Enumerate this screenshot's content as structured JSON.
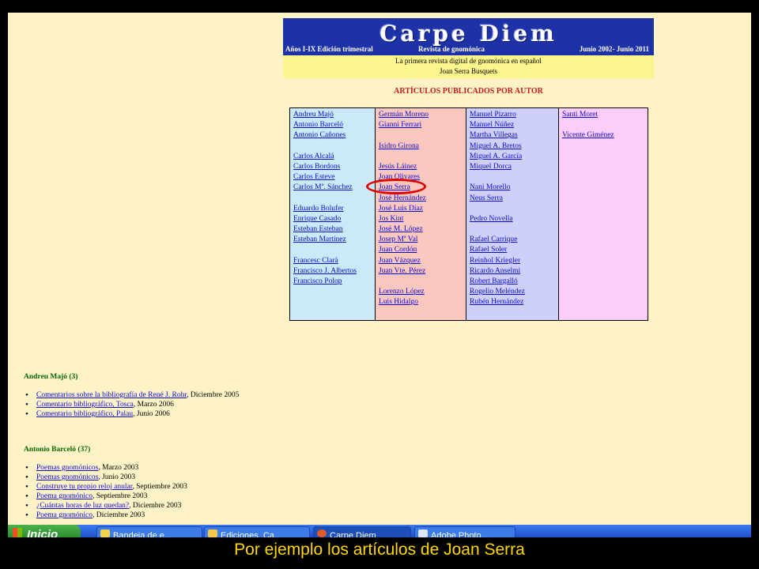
{
  "banner": {
    "logo": "Carpe Diem",
    "left": "Años I-IX Edición trimestral",
    "middle": "Revista de gnomónica",
    "right": "Junio 2002- Junio 2011",
    "line1": "La primera revista digital de gnomónica en español",
    "line2": "Joan Serra Busquets"
  },
  "heading": "ARTÍCULOS PUBLICADOS POR AUTOR",
  "columns": [
    [
      "Andreu Majó",
      "Antonio Barceló",
      "Antonio Cañones",
      "",
      "Carlos Alcalá",
      "Carlos Bordons",
      "Carlos Esteve",
      "Carlos Mª. Sánchez",
      "",
      "Eduardo Bolufer",
      "Enrique Casado",
      "Esteban Esteban",
      "Esteban Martínez",
      "",
      "Francesc Clarà",
      "Francisco J. Albertos",
      "Francisco Polop"
    ],
    [
      "Germán Moreno",
      "Gianni Ferrari",
      "",
      "Isidro Girona",
      "",
      "Jesús Láinez",
      "Joan Olivares",
      "Joan Serra",
      "José Hernández",
      "José Luis Díaz",
      "Jos Kint",
      "José M. López",
      "Josep Mª Val",
      "Juan Cordón",
      "Juan Vázquez",
      "Juan Vte. Pérez",
      "",
      "Lorenzo López",
      "Luis Hidalgo"
    ],
    [
      "Manuel Pizarro",
      "Manuel Núñez",
      "Martha Villegas",
      "Miguel A. Bretos",
      "Miguel A. García",
      "Miquel Dorca",
      "",
      "Nani Morello",
      "Neus Serra",
      "",
      "Pedro Novella",
      "",
      "Rafael Carrique",
      "Rafael Soler",
      "Reinhol Kriegler",
      "Ricardo Anselmi",
      "Robert Bargalló",
      "Rogelio Meléndez",
      "Rubén Hernández"
    ],
    [
      "Santi Moret",
      "",
      "Vicente Giménez"
    ]
  ],
  "sections": [
    {
      "title": "Andreu Majó (3)",
      "items": [
        {
          "link": "Comentarios sobre la bibliografía de René J. Rohr",
          "rest": ", Diciembre 2005"
        },
        {
          "link": "Comentario bibliográfico, Tosca",
          "rest": ", Marzo 2006"
        },
        {
          "link": "Comentario bibliográfico, Palau",
          "rest": ",  Junio 2006"
        }
      ]
    },
    {
      "title": "Antonio Barceló (37)",
      "items": [
        {
          "link": "Poemas gnomónicos",
          "rest": ", Marzo 2003"
        },
        {
          "link": "Poemas gnomónicos",
          "rest": ", Junio 2003"
        },
        {
          "link": "Construye tu propio reloj anular",
          "rest": ", Septiembre 2003"
        },
        {
          "link": "Poema gnomónico",
          "rest": ", Septiembre 2003"
        },
        {
          "link": "¿Cuántas horas de luz quedan?",
          "rest": ", Diciembre 2003"
        },
        {
          "link": "Poema gnomónico",
          "rest": ", Diciembre 2003"
        }
      ]
    }
  ],
  "taskbar": {
    "start": "Inicio",
    "buttons": [
      "Bandeja de e...",
      "Ediciones_Ca...",
      "Carpe Diem",
      "Adobe Photo..."
    ]
  },
  "caption": "Por ejemplo los artículos de Joan Serra",
  "colors": {
    "banner_blue": "#1e32a8",
    "heading_red": "#c71818",
    "highlight": "#e00000",
    "caption_yellow": "#ffd700"
  }
}
